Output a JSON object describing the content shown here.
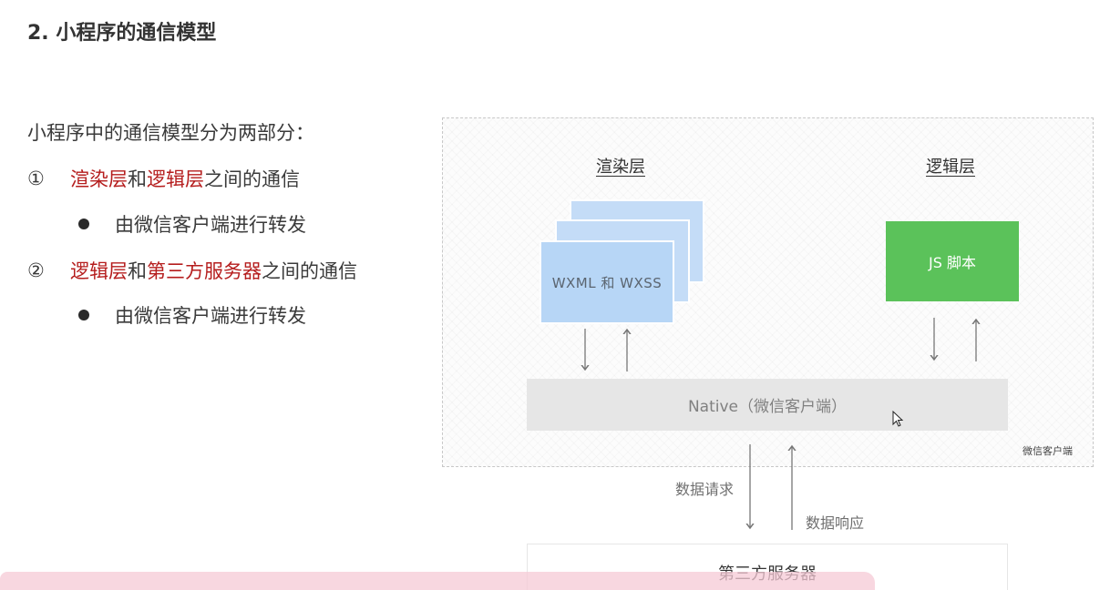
{
  "heading": "2. 小程序的通信模型",
  "intro": "小程序中的通信模型分为两部分：",
  "points": [
    {
      "num": "①",
      "part1": "渲染层",
      "conj": "和",
      "part2": "逻辑层",
      "suffix": "之间的通信",
      "bullet": "由微信客户端进行转发"
    },
    {
      "num": "②",
      "part1": "逻辑层",
      "conj": "和",
      "part2": "第三方服务器",
      "suffix": "之间的通信",
      "bullet": "由微信客户端进行转发"
    }
  ],
  "diagram": {
    "render_layer_label": "渲染层",
    "logic_layer_label": "逻辑层",
    "render_card_text": "WXML 和 WXSS",
    "js_box_text": "JS 脚本",
    "native_text": "Native（微信客户端）",
    "client_caption": "微信客户端",
    "request_label": "数据请求",
    "response_label": "数据响应",
    "server_text": "第三方服务器",
    "colors": {
      "card_blue": "#b7d6f6",
      "js_green": "#5bc25a",
      "native_gray": "#e6e6e6",
      "accent_red": "#b51d1d"
    }
  }
}
